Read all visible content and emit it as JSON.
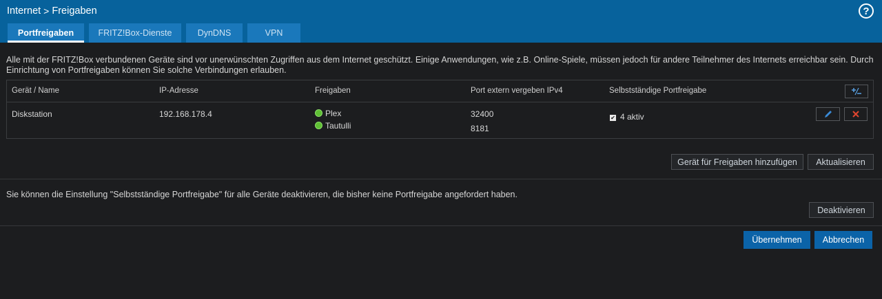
{
  "breadcrumb": {
    "parent": "Internet",
    "separator": ">",
    "current": "Freigaben"
  },
  "help_label": "?",
  "tabs": [
    {
      "label": "Portfreigaben",
      "active": true
    },
    {
      "label": "FRITZ!Box-Dienste",
      "active": false
    },
    {
      "label": "DynDNS",
      "active": false
    },
    {
      "label": "VPN",
      "active": false
    }
  ],
  "intro": "Alle mit der FRITZ!Box verbundenen Geräte sind vor unerwünschten Zugriffen aus dem Internet geschützt. Einige Anwendungen, wie z.B. Online-Spiele, müssen jedoch für andere Teilnehmer des Internets erreichbar sein. Durch Einrichtung von Portfreigaben können Sie solche Verbindungen erlauben.",
  "table": {
    "headers": {
      "device": "Gerät / Name",
      "ip": "IP-Adresse",
      "shares": "Freigaben",
      "port": "Port extern vergeben IPv4",
      "auto": "Selbstständige Portfreigabe"
    },
    "rows": [
      {
        "device": "Diskstation",
        "ip": "192.168.178.4",
        "shares": [
          "Plex",
          "Tautulli"
        ],
        "ports": [
          "32400",
          "8181"
        ],
        "auto_checked": true,
        "auto_label": "4 aktiv"
      }
    ]
  },
  "buttons": {
    "add_device": "Gerät für Freigaben hinzufügen",
    "refresh": "Aktualisieren",
    "deactivate": "Deaktivieren",
    "apply": "Übernehmen",
    "cancel": "Abbrechen"
  },
  "note": "Sie können die Einstellung \"Selbstständige Portfreigabe\" für alle Geräte deaktivieren, die bisher keine Portfreigabe angefordert haben.",
  "colors": {
    "header_bg": "#07629c",
    "tab_bg": "#1a78bb",
    "primary_button": "#0b63a8",
    "status_green": "#5fbf34",
    "delete_red": "#e0452f",
    "edit_blue": "#3a8ad6"
  },
  "icons": {
    "add_remove": "plus-minus-icon",
    "edit": "pencil-icon",
    "delete": "x-icon",
    "help": "question-circle-icon"
  }
}
